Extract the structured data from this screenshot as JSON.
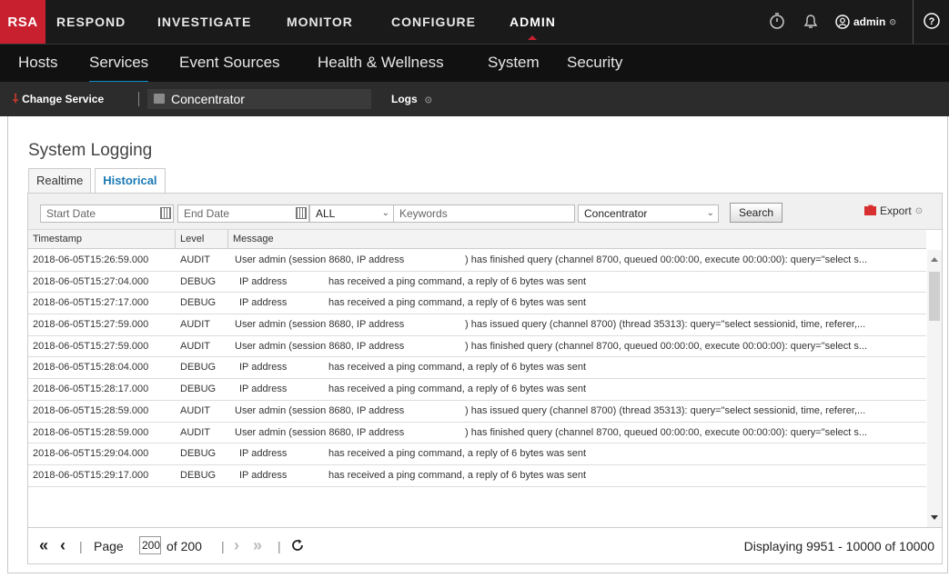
{
  "topnav": {
    "logo": "RSA",
    "items": [
      "RESPOND",
      "INVESTIGATE",
      "MONITOR",
      "CONFIGURE",
      "ADMIN"
    ],
    "active": "ADMIN",
    "user": "admin",
    "help": "?"
  },
  "subnav": {
    "items": [
      "Hosts",
      "Services",
      "Event Sources",
      "Health & Wellness",
      "System",
      "Security"
    ],
    "active": "Services"
  },
  "servbar": {
    "change_service": "Change Service",
    "service_name": "Concentrator",
    "menu": "Logs"
  },
  "page": {
    "title": "System Logging",
    "tabs": [
      "Realtime",
      "Historical"
    ],
    "active_tab": "Historical"
  },
  "toolbar": {
    "start_date_placeholder": "Start Date",
    "end_date_placeholder": "End Date",
    "level_value": "ALL",
    "keywords_placeholder": "Keywords",
    "service_value": "Concentrator",
    "search_label": "Search",
    "export_label": "Export"
  },
  "grid": {
    "columns": [
      "Timestamp",
      "Level",
      "Message"
    ],
    "rows": [
      [
        "2018-06-05T15:26:59.000",
        "AUDIT",
        "User admin (session 8680,  IP address",
        ") has finished query (channel 8700, queued 00:00:00, execute 00:00:00): query=\"select s..."
      ],
      [
        "2018-06-05T15:27:04.000",
        "DEBUG",
        "IP address",
        "has received a ping command, a reply of 6 bytes was sent"
      ],
      [
        "2018-06-05T15:27:17.000",
        "DEBUG",
        "IP address",
        "has received a ping command, a reply of 6 bytes was sent"
      ],
      [
        "2018-06-05T15:27:59.000",
        "AUDIT",
        "User admin (session 8680,  IP address",
        ") has issued query (channel 8700) (thread 35313): query=\"select sessionid, time, referer,..."
      ],
      [
        "2018-06-05T15:27:59.000",
        "AUDIT",
        "User admin (session 8680,  IP address",
        ") has finished query (channel 8700, queued 00:00:00, execute 00:00:00): query=\"select s..."
      ],
      [
        "2018-06-05T15:28:04.000",
        "DEBUG",
        "IP address",
        "has received a ping command, a reply of 6 bytes was sent"
      ],
      [
        "2018-06-05T15:28:17.000",
        "DEBUG",
        "IP address",
        "has received a ping command, a reply of 6 bytes was sent"
      ],
      [
        "2018-06-05T15:28:59.000",
        "AUDIT",
        "User admin (session 8680,  IP address",
        ") has issued query (channel 8700) (thread 35313): query=\"select sessionid, time, referer,..."
      ],
      [
        "2018-06-05T15:28:59.000",
        "AUDIT",
        "User admin (session 8680,  IP address",
        ") has finished query (channel 8700, queued 00:00:00, execute 00:00:00): query=\"select s..."
      ],
      [
        "2018-06-05T15:29:04.000",
        "DEBUG",
        "IP address",
        "has received a ping command, a reply of 6 bytes was sent"
      ],
      [
        "2018-06-05T15:29:17.000",
        "DEBUG",
        "IP address",
        "has received a ping command, a reply of 6 bytes was sent"
      ]
    ]
  },
  "pager": {
    "page_label": "Page",
    "page_value": "200",
    "of_label": "of 200",
    "display": "Displaying 9951 - 10000 of 10000"
  },
  "colors": {
    "brand_red": "#c8202f",
    "accent_blue": "#0b8ec9",
    "tab_active": "#1a7ab5"
  }
}
